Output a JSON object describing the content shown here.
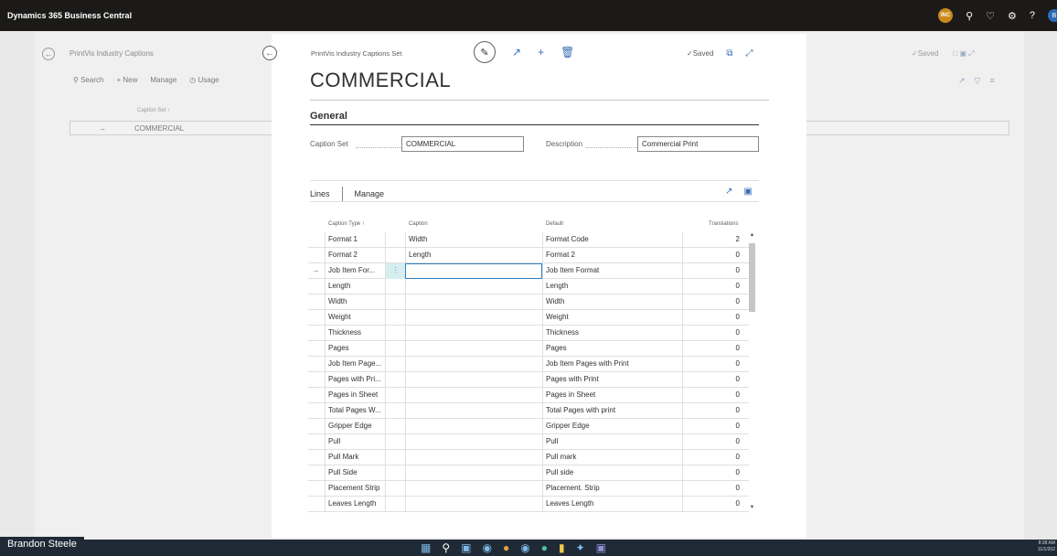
{
  "app": {
    "title": "Dynamics 365 Business Central",
    "company_badge": "INC",
    "user_initial": "B"
  },
  "header_icons": [
    "search-icon",
    "bell-icon",
    "gear-icon",
    "help-icon"
  ],
  "background_page": {
    "breadcrumb": "PrintVis Industry Captions",
    "actions": {
      "search": "Search",
      "new": "New",
      "manage": "Manage",
      "usage": "Usage"
    },
    "column_header": "Caption Set ↑",
    "row": {
      "marker": "→",
      "value": "COMMERCIAL"
    },
    "status": "✓Saved"
  },
  "card": {
    "breadcrumb": "PrintVis Industry Captions Set",
    "status": "✓Saved",
    "title": "COMMERCIAL",
    "general": {
      "heading": "General",
      "caption_set_label": "Caption Set",
      "caption_set_value": "COMMERCIAL",
      "description_label": "Description",
      "description_value": "Commercial Print"
    },
    "lines": {
      "tab_label": "Lines",
      "manage_label": "Manage",
      "columns": [
        "Caption Type ↑",
        "Caption",
        "Default",
        "Translations"
      ],
      "rows": [
        {
          "marker": "",
          "type": "Format 1",
          "caption": "Width",
          "default": "Format Code",
          "translations": "2"
        },
        {
          "marker": "",
          "type": "Format 2",
          "caption": "Length",
          "default": "Format 2",
          "translations": "0"
        },
        {
          "marker": "→",
          "type": "Job Item For...",
          "caption": "",
          "default": "Job Item Format",
          "translations": "0",
          "active": true
        },
        {
          "marker": "",
          "type": "Length",
          "caption": "",
          "default": "Length",
          "translations": "0"
        },
        {
          "marker": "",
          "type": "Width",
          "caption": "",
          "default": "Width",
          "translations": "0"
        },
        {
          "marker": "",
          "type": "Weight",
          "caption": "",
          "default": "Weight",
          "translations": "0"
        },
        {
          "marker": "",
          "type": "Thickness",
          "caption": "",
          "default": "Thickness",
          "translations": "0"
        },
        {
          "marker": "",
          "type": "Pages",
          "caption": "",
          "default": "Pages",
          "translations": "0"
        },
        {
          "marker": "",
          "type": "Job Item Page...",
          "caption": "",
          "default": "Job Item Pages with Print",
          "translations": "0"
        },
        {
          "marker": "",
          "type": "Pages with Pri...",
          "caption": "",
          "default": "Pages with Print",
          "translations": "0"
        },
        {
          "marker": "",
          "type": "Pages in Sheet",
          "caption": "",
          "default": "Pages in Sheet",
          "translations": "0"
        },
        {
          "marker": "",
          "type": "Total Pages W...",
          "caption": "",
          "default": "Total Pages with print",
          "translations": "0"
        },
        {
          "marker": "",
          "type": "Gripper Edge",
          "caption": "",
          "default": "Gripper Edge",
          "translations": "0"
        },
        {
          "marker": "",
          "type": "Pull",
          "caption": "",
          "default": "Pull",
          "translations": "0"
        },
        {
          "marker": "",
          "type": "Pull Mark",
          "caption": "",
          "default": "Pull mark",
          "translations": "0"
        },
        {
          "marker": "",
          "type": "Pull Side",
          "caption": "",
          "default": "Pull side",
          "translations": "0"
        },
        {
          "marker": "",
          "type": "Placement Strip",
          "caption": "",
          "default": "Placement. Strip",
          "translations": "0"
        },
        {
          "marker": "",
          "type": "Leaves Length",
          "caption": "",
          "default": "Leaves Length",
          "translations": "0"
        }
      ]
    }
  },
  "taskbar": {
    "presenter": "Brandon Steele",
    "time": "8:38 AM",
    "date": "11/1/202"
  },
  "colors": {
    "topbar": "#1b1a19",
    "accent": "#3b6fb6",
    "active_cell_border": "#2f7fc1",
    "badge": "#c98a1a"
  }
}
